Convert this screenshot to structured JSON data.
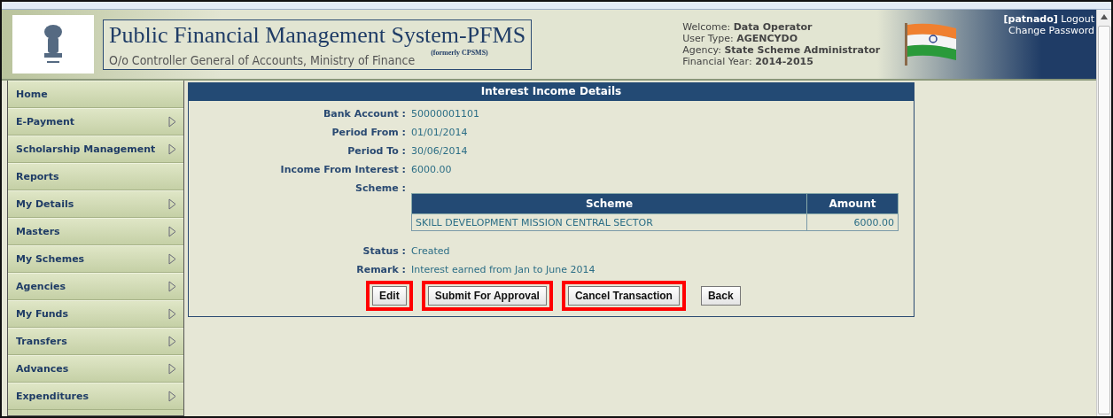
{
  "header": {
    "title": "Public Financial Management System-PFMS",
    "formerly": "(formerly CPSMS)",
    "subtitle": "O/o Controller General of Accounts, Ministry of Finance",
    "user_info": [
      {
        "label": "Welcome:",
        "value": "Data Operator"
      },
      {
        "label": "User Type:",
        "value": "AGENCYDO"
      },
      {
        "label": "Agency:",
        "value": "State Scheme Administrator"
      },
      {
        "label": "Financial Year:",
        "value": "2014-2015"
      }
    ],
    "username": "[patnado]",
    "logout": "Logout",
    "change_password": "Change Password"
  },
  "sidebar": {
    "items": [
      {
        "label": "Home",
        "has_submenu": false
      },
      {
        "label": "E-Payment",
        "has_submenu": true
      },
      {
        "label": "Scholarship Management",
        "has_submenu": true
      },
      {
        "label": "Reports",
        "has_submenu": false
      },
      {
        "label": "My Details",
        "has_submenu": true
      },
      {
        "label": "Masters",
        "has_submenu": true
      },
      {
        "label": "My Schemes",
        "has_submenu": true
      },
      {
        "label": "Agencies",
        "has_submenu": true
      },
      {
        "label": "My Funds",
        "has_submenu": true
      },
      {
        "label": "Transfers",
        "has_submenu": true
      },
      {
        "label": "Advances",
        "has_submenu": true
      },
      {
        "label": "Expenditures",
        "has_submenu": true
      }
    ]
  },
  "panel": {
    "title": "Interest Income Details",
    "fields": [
      {
        "label": "Bank Account :",
        "value": "50000001101"
      },
      {
        "label": "Period From :",
        "value": "01/01/2014"
      },
      {
        "label": "Period To :",
        "value": "30/06/2014"
      },
      {
        "label": "Income From Interest :",
        "value": "6000.00"
      }
    ],
    "scheme_label": "Scheme :",
    "scheme_table": {
      "columns": [
        "Scheme",
        "Amount"
      ],
      "rows": [
        [
          "SKILL DEVELOPMENT MISSION CENTRAL SECTOR",
          "6000.00"
        ]
      ]
    },
    "after_fields": [
      {
        "label": "Status :",
        "value": "Created"
      },
      {
        "label": "Remark :",
        "value": "Interest earned from Jan to June 2014"
      }
    ],
    "buttons": [
      {
        "label": "Edit",
        "highlighted": true
      },
      {
        "label": "Submit For Approval",
        "highlighted": true
      },
      {
        "label": "Cancel Transaction",
        "highlighted": true
      },
      {
        "label": "Back",
        "highlighted": false
      }
    ]
  }
}
